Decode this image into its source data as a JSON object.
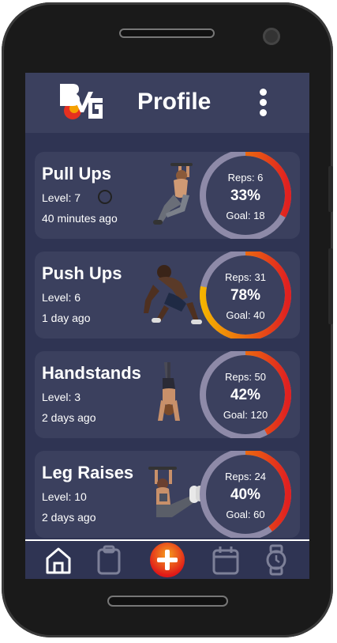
{
  "header": {
    "title": "Profile"
  },
  "colors": {
    "ring_track": "#8e8aa8",
    "ring_start": "#f5b300",
    "ring_end": "#e02020",
    "accent": "#e53020"
  },
  "exercises": [
    {
      "name": "Pull Ups",
      "level": "Level: 7",
      "time": "40 minutes ago",
      "reps": "Reps: 6",
      "percent": "33%",
      "goal": "Goal: 18",
      "progress": 0.33
    },
    {
      "name": "Push Ups",
      "level": "Level: 6",
      "time": "1 day ago",
      "reps": "Reps: 31",
      "percent": "78%",
      "goal": "Goal: 40",
      "progress": 0.78
    },
    {
      "name": "Handstands",
      "level": "Level: 3",
      "time": "2 days ago",
      "reps": "Reps: 50",
      "percent": "42%",
      "goal": "Goal: 120",
      "progress": 0.42
    },
    {
      "name": "Leg Raises",
      "level": "Level: 10",
      "time": "2 days ago",
      "reps": "Reps: 24",
      "percent": "40%",
      "goal": "Goal: 60",
      "progress": 0.4
    }
  ],
  "nav": [
    {
      "icon": "home-icon"
    },
    {
      "icon": "clipboard-icon"
    },
    {
      "icon": "add-icon"
    },
    {
      "icon": "calendar-icon"
    },
    {
      "icon": "watch-icon"
    }
  ]
}
